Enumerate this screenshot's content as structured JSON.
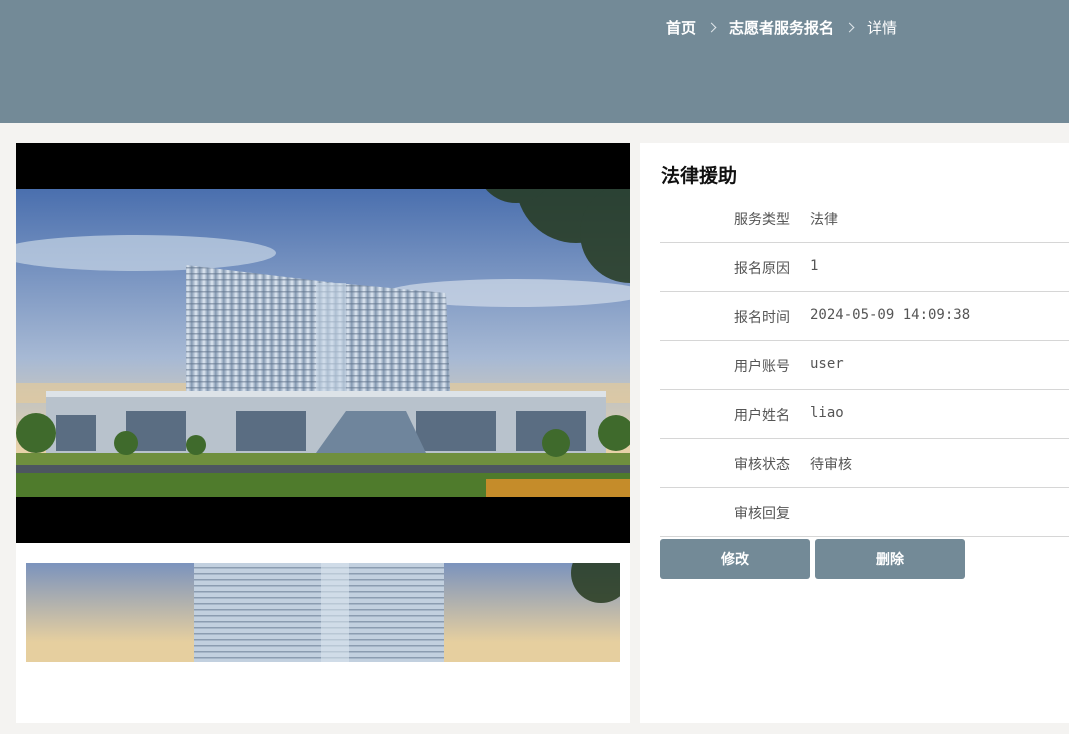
{
  "breadcrumb": {
    "home": "首页",
    "section": "志愿者服务报名",
    "current": "详情"
  },
  "detail": {
    "title": "法律援助",
    "fields": [
      {
        "label": "服务类型",
        "value": "法律"
      },
      {
        "label": "报名原因",
        "value": "1"
      },
      {
        "label": "报名时间",
        "value": "2024-05-09 14:09:38"
      },
      {
        "label": "用户账号",
        "value": "user"
      },
      {
        "label": "用户姓名",
        "value": "liao"
      },
      {
        "label": "审核状态",
        "value": "待审核"
      },
      {
        "label": "审核回复",
        "value": ""
      }
    ]
  },
  "actions": {
    "edit_label": "修改",
    "delete_label": "删除"
  },
  "colors": {
    "header": "#738a97",
    "button": "#738a97",
    "page_bg": "#f4f3f1"
  },
  "images": {
    "main": "building-photo",
    "thumbnail": "building-photo-thumbnail"
  }
}
